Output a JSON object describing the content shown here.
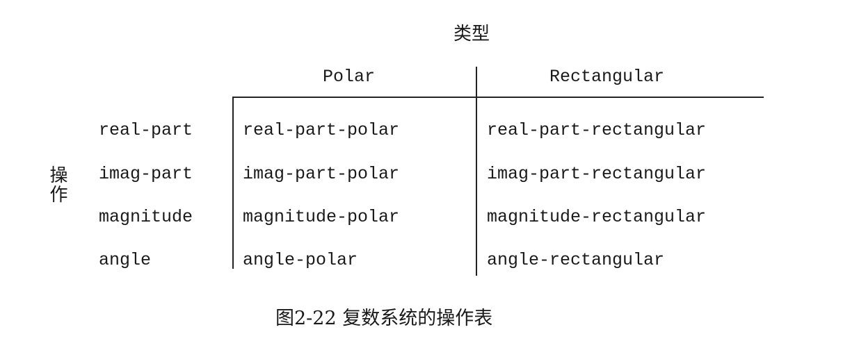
{
  "table": {
    "type_header": "类型",
    "operation_header": "操作",
    "columns": [
      "Polar",
      "Rectangular"
    ],
    "rows": [
      {
        "op": "real-part",
        "polar": "real-part-polar",
        "rectangular": "real-part-rectangular"
      },
      {
        "op": "imag-part",
        "polar": "imag-part-polar",
        "rectangular": "imag-part-rectangular"
      },
      {
        "op": "magnitude",
        "polar": "magnitude-polar",
        "rectangular": "magnitude-rectangular"
      },
      {
        "op": "angle",
        "polar": "angle-polar",
        "rectangular": "angle-rectangular"
      }
    ]
  },
  "caption": "图2-22  复数系统的操作表"
}
